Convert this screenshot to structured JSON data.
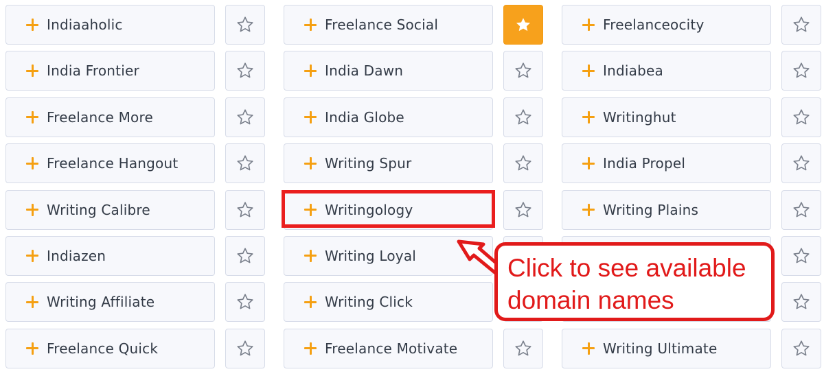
{
  "columns": [
    {
      "rows": [
        {
          "label": "Indiaaholic",
          "favorite": false
        },
        {
          "label": "India Frontier",
          "favorite": false
        },
        {
          "label": "Freelance More",
          "favorite": false
        },
        {
          "label": "Freelance Hangout",
          "favorite": false
        },
        {
          "label": "Writing Calibre",
          "favorite": false
        },
        {
          "label": "Indiazen",
          "favorite": false
        },
        {
          "label": "Writing Affiliate",
          "favorite": false
        },
        {
          "label": "Freelance Quick",
          "favorite": false
        }
      ]
    },
    {
      "rows": [
        {
          "label": "Freelance Social",
          "favorite": true
        },
        {
          "label": "India Dawn",
          "favorite": false
        },
        {
          "label": "India Globe",
          "favorite": false
        },
        {
          "label": "Writing Spur",
          "favorite": false
        },
        {
          "label": "Writingology",
          "favorite": false
        },
        {
          "label": "Writing Loyal",
          "favorite": false
        },
        {
          "label": "Writing Click",
          "favorite": false
        },
        {
          "label": "Freelance Motivate",
          "favorite": false
        }
      ]
    },
    {
      "rows": [
        {
          "label": "Freelanceocity",
          "favorite": false
        },
        {
          "label": "Indiabea",
          "favorite": false
        },
        {
          "label": "Writinghut",
          "favorite": false
        },
        {
          "label": "India Propel",
          "favorite": false
        },
        {
          "label": "Writing Plains",
          "favorite": false
        },
        {
          "label": "",
          "favorite": false
        },
        {
          "label": "",
          "favorite": false
        },
        {
          "label": "Writing Ultimate",
          "favorite": false
        }
      ]
    }
  ],
  "callout": {
    "line1": "Click to see available",
    "line2": "domain names"
  },
  "icons": {
    "add": "plus-icon",
    "favorite": "star-icon"
  },
  "colors": {
    "accent": "#f5a012",
    "favorite_fill": "#f7a11c",
    "annotation": "#e11a1a",
    "button_bg": "#f7f8fc",
    "button_border": "#d6dbe8",
    "text": "#333b47"
  }
}
